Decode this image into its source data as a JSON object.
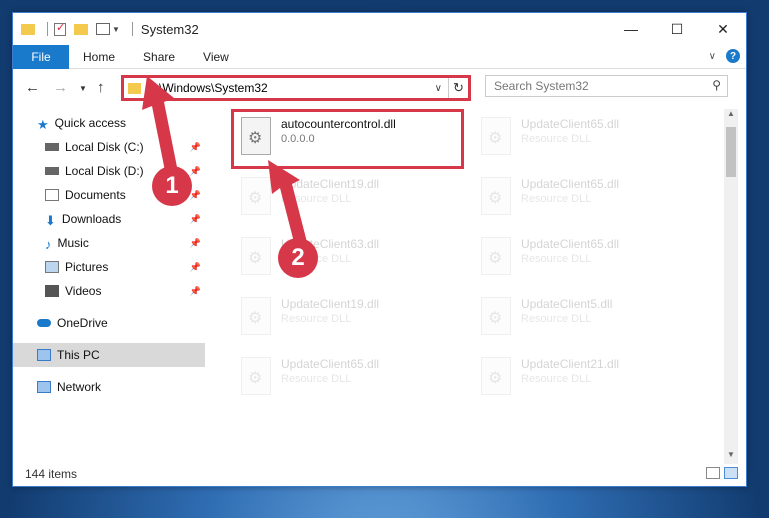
{
  "window": {
    "title": "System32"
  },
  "ribbon": {
    "file": "File",
    "tabs": [
      "Home",
      "Share",
      "View"
    ]
  },
  "address": {
    "path": "C:\\Windows\\System32"
  },
  "search": {
    "placeholder": "Search System32"
  },
  "sidebar": {
    "items": [
      {
        "label": "Quick access",
        "icon": "star-icon"
      },
      {
        "label": "Local Disk (C:)",
        "icon": "drive-icon"
      },
      {
        "label": "Local Disk (D:)",
        "icon": "drive-icon"
      },
      {
        "label": "Documents",
        "icon": "documents-icon"
      },
      {
        "label": "Downloads",
        "icon": "download-icon"
      },
      {
        "label": "Music",
        "icon": "music-icon"
      },
      {
        "label": "Pictures",
        "icon": "pictures-icon"
      },
      {
        "label": "Videos",
        "icon": "videos-icon"
      },
      {
        "label": "OneDrive",
        "icon": "cloud-icon"
      },
      {
        "label": "This PC",
        "icon": "computer-icon"
      },
      {
        "label": "Network",
        "icon": "network-icon"
      }
    ]
  },
  "files": [
    {
      "name": "autocountercontrol.dll",
      "sub": "0.0.0.0"
    },
    {
      "name": "UpdateClient65.dll",
      "sub": "Resource DLL"
    },
    {
      "name": "UpdateClient19.dll",
      "sub": "Resource DLL"
    },
    {
      "name": "UpdateClient65.dll",
      "sub": "Resource DLL"
    },
    {
      "name": "UpdateClient63.dll",
      "sub": "Resource DLL"
    },
    {
      "name": "UpdateClient65.dll",
      "sub": "Resource DLL"
    },
    {
      "name": "UpdateClient19.dll",
      "sub": "Resource DLL"
    },
    {
      "name": "UpdateClient5.dll",
      "sub": "Resource DLL"
    },
    {
      "name": "UpdateClient65.dll",
      "sub": "Resource DLL"
    },
    {
      "name": "UpdateClient21.dll",
      "sub": "Resource DLL"
    }
  ],
  "status": {
    "items": "144 items"
  },
  "annotations": {
    "step1": "1",
    "step2": "2"
  },
  "colors": {
    "accent": "#1979ca",
    "highlight": "#d6384a"
  }
}
